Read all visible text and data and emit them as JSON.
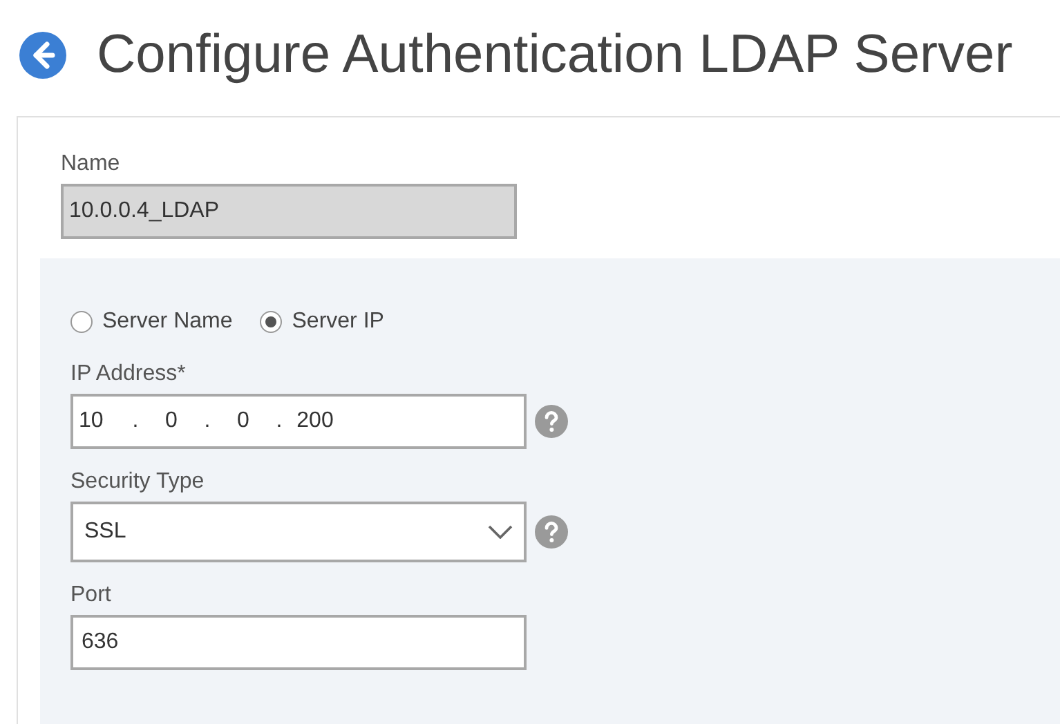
{
  "title": "Configure Authentication LDAP Server",
  "name": {
    "label": "Name",
    "value": "10.0.0.4_LDAP",
    "disabled": true
  },
  "server_type": [
    {
      "label": "Server Name",
      "selected": false
    },
    {
      "label": "Server IP",
      "selected": true
    }
  ],
  "ip_address": {
    "label": "IP Address*",
    "octets": [
      "10",
      "0",
      "0",
      "200"
    ],
    "separator": "."
  },
  "security_type": {
    "label": "Security Type",
    "value": "SSL"
  },
  "port": {
    "label": "Port",
    "value": "636"
  }
}
